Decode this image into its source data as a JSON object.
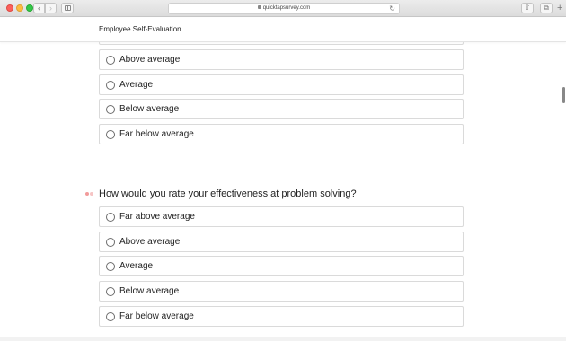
{
  "browser": {
    "url": "quicktapsurvey.com",
    "icons": {
      "back": "chevron-left-icon",
      "forward": "chevron-right-icon",
      "reload": "reload-icon",
      "share": "share-icon",
      "tabs": "tabs-icon",
      "new_tab": "plus-icon"
    },
    "back_glyph": "‹",
    "forward_glyph": "›",
    "reload_glyph": "↻",
    "share_glyph": "⇧",
    "tabs_glyph": "⧉",
    "plus_glyph": "+"
  },
  "header": {
    "title": "Employee Self-Evaluation"
  },
  "question_1_options": [
    {
      "label": "Above average"
    },
    {
      "label": "Average"
    },
    {
      "label": "Below average"
    },
    {
      "label": "Far below average"
    }
  ],
  "question_2": {
    "text": "How would you rate your effectiveness at problem solving?",
    "options": [
      {
        "label": "Far above average"
      },
      {
        "label": "Above average"
      },
      {
        "label": "Average"
      },
      {
        "label": "Below average"
      },
      {
        "label": "Far below average"
      }
    ]
  },
  "colors": {
    "required_marker": "#f29b9b",
    "option_border": "#dadada"
  }
}
